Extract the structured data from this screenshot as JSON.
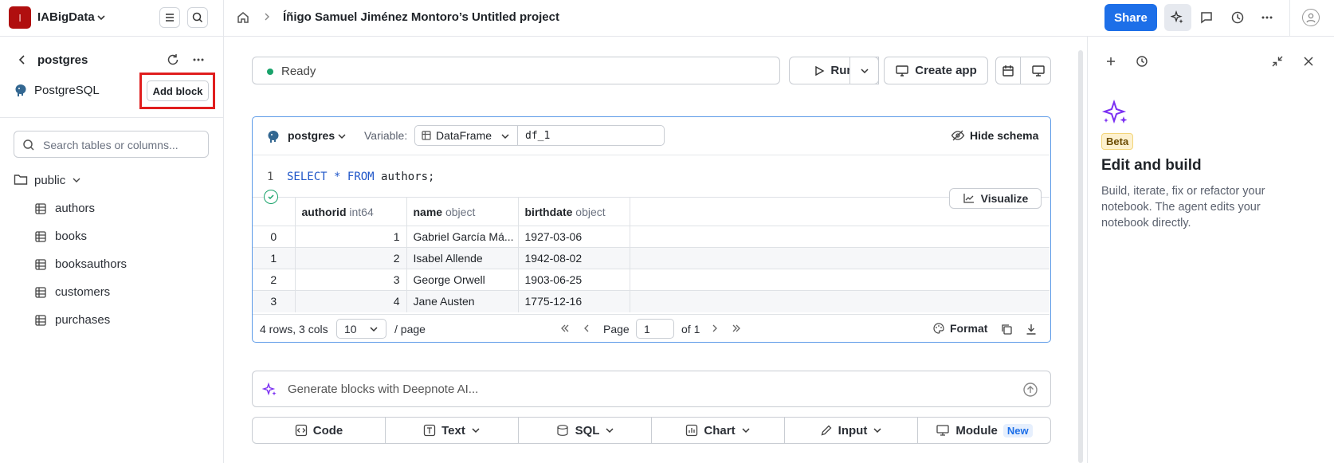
{
  "workspace": {
    "initial": "I",
    "name": "IABigData"
  },
  "breadcrumb": {
    "project_title": "Íñigo Samuel Jiménez Montoro’s Untitled project"
  },
  "topbar": {
    "share_label": "Share"
  },
  "sidebar": {
    "integration_title": "postgres",
    "db_type": "PostgreSQL",
    "add_block_label": "Add block",
    "search_placeholder": "Search tables or columns...",
    "schema": "public",
    "tables": [
      "authors",
      "books",
      "booksauthors",
      "customers",
      "purchases"
    ]
  },
  "toolbar": {
    "status": "Ready",
    "run_label": "Run",
    "create_app_label": "Create app"
  },
  "block": {
    "integration": "postgres",
    "variable_label": "Variable:",
    "variable_type": "DataFrame",
    "variable_name": "df_1",
    "hide_schema_label": "Hide schema",
    "line_number": "1",
    "sql": {
      "kw1": "SELECT",
      "star": "*",
      "kw2": "FROM",
      "rest": "authors;"
    },
    "visualize_label": "Visualize",
    "columns": [
      {
        "name": "authorid",
        "type": "int64"
      },
      {
        "name": "name",
        "type": "object"
      },
      {
        "name": "birthdate",
        "type": "object"
      }
    ],
    "rows": [
      {
        "index": "0",
        "authorid": "1",
        "name": "Gabriel García Má...",
        "birthdate": "1927-03-06"
      },
      {
        "index": "1",
        "authorid": "2",
        "name": "Isabel Allende",
        "birthdate": "1942-08-02"
      },
      {
        "index": "2",
        "authorid": "3",
        "name": "George Orwell",
        "birthdate": "1903-06-25"
      },
      {
        "index": "3",
        "authorid": "4",
        "name": "Jane Austen",
        "birthdate": "1775-12-16"
      }
    ],
    "pager": {
      "summary": "4 rows, 3 cols",
      "page_size": "10",
      "per_page": "/ page",
      "page_label": "Page",
      "page": "1",
      "of": "of 1",
      "format_label": "Format"
    }
  },
  "ai_input": {
    "placeholder": "Generate blocks with Deepnote AI..."
  },
  "add_bar": {
    "code": "Code",
    "text": "Text",
    "sql": "SQL",
    "chart": "Chart",
    "input": "Input",
    "module": "Module",
    "new_badge": "New"
  },
  "right_panel": {
    "beta": "Beta",
    "title": "Edit and build",
    "description": "Build, iterate, fix or refactor your notebook. The agent edits your notebook directly."
  },
  "colors": {
    "accent": "#1d6fe8",
    "ai_purple": "#7b2ff2",
    "highlight": "#e01e1e",
    "ready": "#19a36b"
  }
}
